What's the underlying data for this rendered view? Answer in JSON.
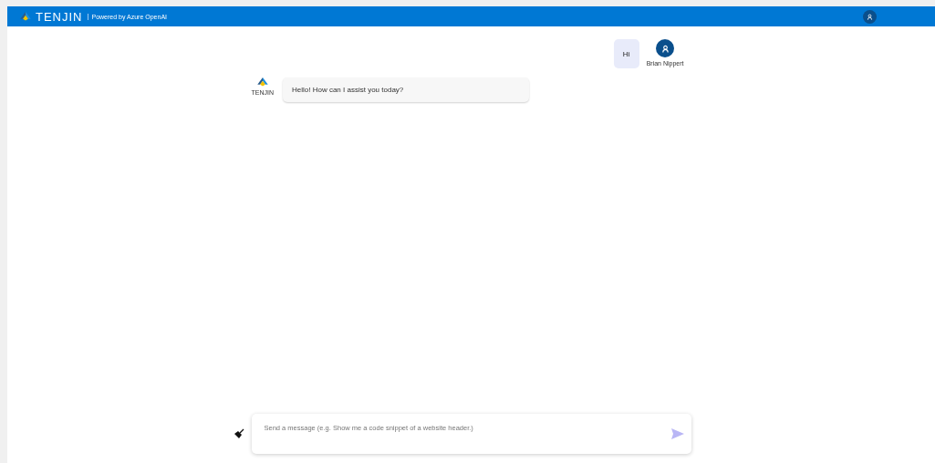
{
  "header": {
    "brand": "TENJIN",
    "tagline": "Powered by Azure OpenAI"
  },
  "messages": [
    {
      "kind": "user",
      "text": "Hi",
      "author": "Brian Nippert"
    },
    {
      "kind": "bot",
      "text": "Hello! How can I assist you today?",
      "author": "TENJIN"
    }
  ],
  "composer": {
    "placeholder": "Send a message (e.g. Show me a code snippet of a website header.)"
  }
}
